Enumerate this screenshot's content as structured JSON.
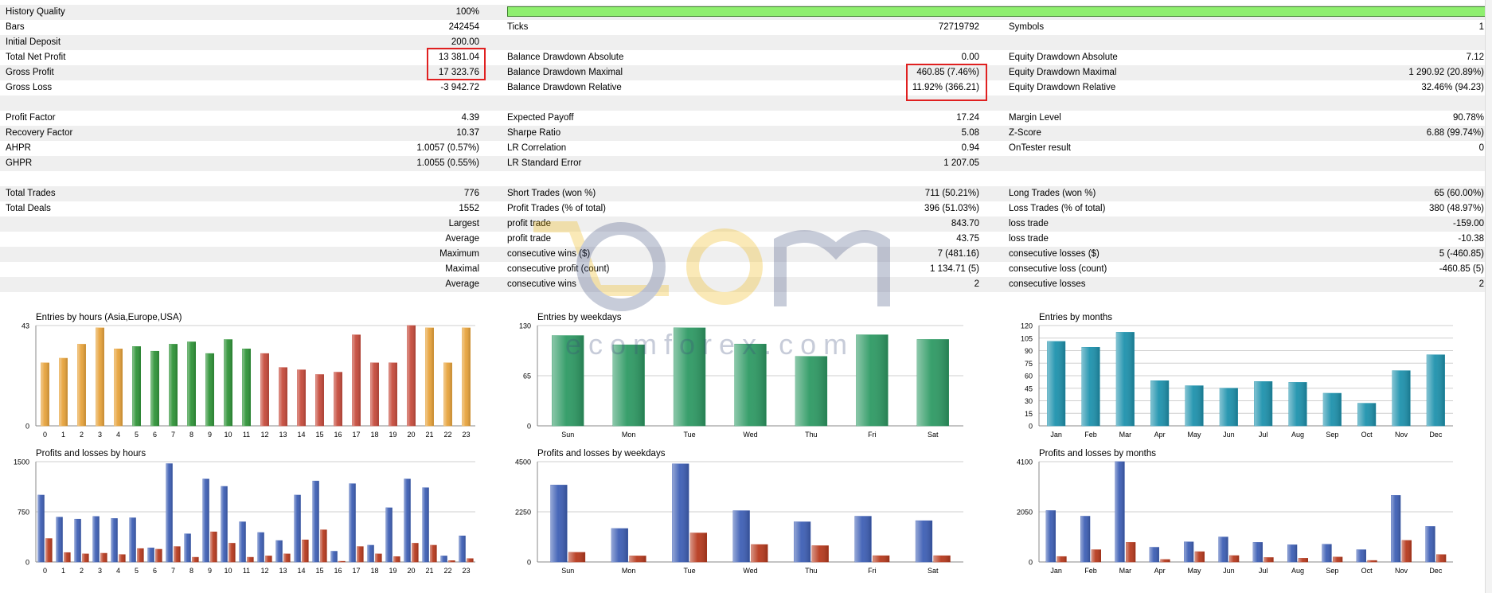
{
  "stats": {
    "rows": [
      {
        "shade": true,
        "l1": "History Quality",
        "v1": "100%",
        "l2": "",
        "v2": "",
        "l3": "",
        "v3": "",
        "bar": true
      },
      {
        "shade": false,
        "l1": "Bars",
        "v1": "242454",
        "l2": "Ticks",
        "v2": "72719792",
        "l3": "Symbols",
        "v3": "1"
      },
      {
        "shade": true,
        "l1": "Initial Deposit",
        "v1": "200.00",
        "l2": "",
        "v2": "",
        "l3": "",
        "v3": ""
      },
      {
        "shade": false,
        "l1": "Total Net Profit",
        "v1": "13 381.04",
        "l2": "Balance Drawdown Absolute",
        "v2": "0.00",
        "l3": "Equity Drawdown Absolute",
        "v3": "7.12"
      },
      {
        "shade": true,
        "l1": "Gross Profit",
        "v1": "17 323.76",
        "l2": "Balance Drawdown Maximal",
        "v2": "460.85 (7.46%)",
        "l3": "Equity Drawdown Maximal",
        "v3": "1 290.92 (20.89%)"
      },
      {
        "shade": false,
        "l1": "Gross Loss",
        "v1": "-3 942.72",
        "l2": "Balance Drawdown Relative",
        "v2": "11.92% (366.21)",
        "l3": "Equity Drawdown Relative",
        "v3": "32.46% (94.23)"
      },
      {
        "shade": true,
        "l1": "",
        "v1": "",
        "l2": "",
        "v2": "",
        "l3": "",
        "v3": ""
      },
      {
        "shade": false,
        "l1": "Profit Factor",
        "v1": "4.39",
        "l2": "Expected Payoff",
        "v2": "17.24",
        "l3": "Margin Level",
        "v3": "90.78%"
      },
      {
        "shade": true,
        "l1": "Recovery Factor",
        "v1": "10.37",
        "l2": "Sharpe Ratio",
        "v2": "5.08",
        "l3": "Z-Score",
        "v3": "6.88 (99.74%)"
      },
      {
        "shade": false,
        "l1": "AHPR",
        "v1": "1.0057 (0.57%)",
        "l2": "LR Correlation",
        "v2": "0.94",
        "l3": "OnTester result",
        "v3": "0"
      },
      {
        "shade": true,
        "l1": "GHPR",
        "v1": "1.0055 (0.55%)",
        "l2": "LR Standard Error",
        "v2": "1 207.05",
        "l3": "",
        "v3": ""
      },
      {
        "shade": false,
        "l1": "",
        "v1": "",
        "l2": "",
        "v2": "",
        "l3": "",
        "v3": ""
      },
      {
        "shade": true,
        "l1": "Total Trades",
        "v1": "776",
        "l2": "Short Trades (won %)",
        "v2": "711 (50.21%)",
        "l3": "Long Trades (won %)",
        "v3": "65 (60.00%)"
      },
      {
        "shade": false,
        "l1": "Total Deals",
        "v1": "1552",
        "l2": "Profit Trades (% of total)",
        "v2": "396 (51.03%)",
        "l3": "Loss Trades (% of total)",
        "v3": "380 (48.97%)"
      },
      {
        "shade": true,
        "l1": "",
        "v1": "Largest",
        "l2": "profit trade",
        "v2": "843.70",
        "l3": "loss trade",
        "v3": "-159.00"
      },
      {
        "shade": false,
        "l1": "",
        "v1": "Average",
        "l2": "profit trade",
        "v2": "43.75",
        "l3": "loss trade",
        "v3": "-10.38"
      },
      {
        "shade": true,
        "l1": "",
        "v1": "Maximum",
        "l2": "consecutive wins ($)",
        "v2": "7 (481.16)",
        "l3": "consecutive losses ($)",
        "v3": "5 (-460.85)"
      },
      {
        "shade": false,
        "l1": "",
        "v1": "Maximal",
        "l2": "consecutive profit (count)",
        "v2": "1 134.71 (5)",
        "l3": "consecutive loss (count)",
        "v3": "-460.85 (5)"
      },
      {
        "shade": true,
        "l1": "",
        "v1": "Average",
        "l2": "consecutive wins",
        "v2": "2",
        "l3": "consecutive losses",
        "v3": "2"
      },
      {
        "shade": false,
        "l1": "",
        "v1": "",
        "l2": "",
        "v2": "",
        "l3": "",
        "v3": ""
      }
    ]
  },
  "watermark": {
    "text": "ecomforex.com"
  },
  "chart_data": [
    {
      "type": "bar",
      "title": "Entries by hours (Asia,Europe,USA)",
      "categories": [
        "0",
        "1",
        "2",
        "3",
        "4",
        "5",
        "6",
        "7",
        "8",
        "9",
        "10",
        "11",
        "12",
        "13",
        "14",
        "15",
        "16",
        "17",
        "18",
        "19",
        "20",
        "21",
        "22",
        "23"
      ],
      "values": [
        27,
        29,
        35,
        42,
        33,
        34,
        32,
        35,
        36,
        31,
        37,
        33,
        31,
        25,
        24,
        22,
        23,
        39,
        27,
        27,
        43,
        42,
        27,
        42
      ],
      "yticks": [
        0,
        43
      ],
      "ylim": [
        0,
        43
      ],
      "colors": [
        "#e7a33b",
        "#e7a33b",
        "#e7a33b",
        "#e7a33b",
        "#e7a33b",
        "#2f9438",
        "#2f9438",
        "#2f9438",
        "#2f9438",
        "#2f9438",
        "#2f9438",
        "#2f9438",
        "#c64b3c",
        "#c64b3c",
        "#c64b3c",
        "#c64b3c",
        "#c64b3c",
        "#c64b3c",
        "#c64b3c",
        "#c64b3c",
        "#c64b3c",
        "#e7a33b",
        "#e7a33b",
        "#e7a33b"
      ]
    },
    {
      "type": "bar",
      "title": "Entries by weekdays",
      "categories": [
        "Sun",
        "Mon",
        "Tue",
        "Wed",
        "Thu",
        "Fri",
        "Sat"
      ],
      "values": [
        117,
        105,
        127,
        106,
        90,
        118,
        112
      ],
      "yticks": [
        0,
        65,
        130
      ],
      "ylim": [
        0,
        130
      ],
      "color": "#2e9a64"
    },
    {
      "type": "bar",
      "title": "Entries by months",
      "categories": [
        "Jan",
        "Feb",
        "Mar",
        "Apr",
        "May",
        "Jun",
        "Jul",
        "Aug",
        "Sep",
        "Oct",
        "Nov",
        "Dec"
      ],
      "values": [
        101,
        94,
        112,
        54,
        48,
        45,
        53,
        52,
        39,
        27,
        66,
        85
      ],
      "yticks": [
        0,
        15,
        30,
        45,
        60,
        75,
        90,
        105,
        120
      ],
      "ylim": [
        0,
        120
      ],
      "color": "#1e92ad"
    },
    {
      "type": "bar",
      "title": "Profits and losses by hours",
      "categories": [
        "0",
        "1",
        "2",
        "3",
        "4",
        "5",
        "6",
        "7",
        "8",
        "9",
        "10",
        "11",
        "12",
        "13",
        "14",
        "15",
        "16",
        "17",
        "18",
        "19",
        "20",
        "21",
        "22",
        "23"
      ],
      "series": [
        {
          "values": [
            1000,
            670,
            640,
            680,
            650,
            660,
            210,
            1470,
            420,
            1240,
            1130,
            600,
            440,
            320,
            1000,
            1210,
            160,
            1170,
            250,
            810,
            1240,
            1110,
            90,
            390
          ],
          "color": "#3e5fb5"
        },
        {
          "values": [
            350,
            140,
            120,
            130,
            110,
            200,
            190,
            230,
            70,
            450,
            280,
            70,
            90,
            120,
            330,
            480,
            10,
            230,
            120,
            80,
            280,
            250,
            20,
            50
          ],
          "color": "#b73a1e"
        }
      ],
      "yticks": [
        0,
        750,
        1500
      ],
      "ylim": [
        0,
        1500
      ]
    },
    {
      "type": "bar",
      "title": "Profits and losses by weekdays",
      "categories": [
        "Sun",
        "Mon",
        "Tue",
        "Wed",
        "Thu",
        "Fri",
        "Sat"
      ],
      "series": [
        {
          "values": [
            3450,
            1500,
            4400,
            2300,
            1800,
            2050,
            1850
          ],
          "color": "#3e5fb5"
        },
        {
          "values": [
            430,
            270,
            1300,
            780,
            730,
            280,
            280
          ],
          "color": "#b73a1e"
        }
      ],
      "yticks": [
        0,
        2250,
        4500
      ],
      "ylim": [
        0,
        4500
      ]
    },
    {
      "type": "bar",
      "title": "Profits and losses by months",
      "categories": [
        "Jan",
        "Feb",
        "Mar",
        "Apr",
        "May",
        "Jun",
        "Jul",
        "Aug",
        "Sep",
        "Oct",
        "Nov",
        "Dec"
      ],
      "series": [
        {
          "values": [
            2100,
            1870,
            4100,
            600,
            820,
            1020,
            800,
            700,
            720,
            500,
            2720,
            1450
          ],
          "color": "#3e5fb5"
        },
        {
          "values": [
            220,
            500,
            800,
            100,
            420,
            260,
            180,
            150,
            200,
            60,
            880,
            300
          ],
          "color": "#b73a1e"
        }
      ],
      "yticks": [
        0,
        2050,
        4100
      ],
      "ylim": [
        0,
        4100
      ]
    }
  ]
}
